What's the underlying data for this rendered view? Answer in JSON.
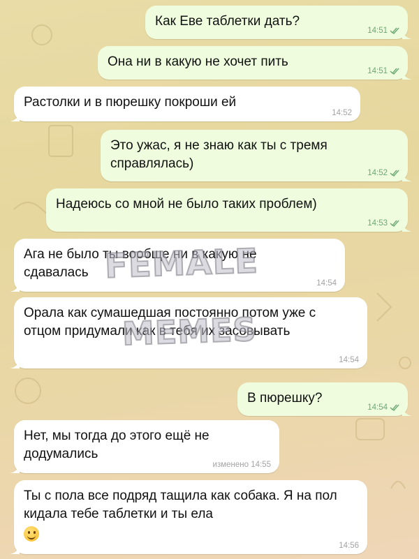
{
  "messages": [
    {
      "dir": "out",
      "text": "Как Еве таблетки дать?",
      "time": "14:51",
      "read": true
    },
    {
      "dir": "out",
      "text": "Она ни в какую не хочет пить",
      "time": "14:51",
      "read": true
    },
    {
      "dir": "in",
      "text": "Растолки и в пюрешку покроши ей",
      "time": "14:52"
    },
    {
      "dir": "out",
      "text": "Это ужас, я не знаю как ты с тремя справлялась)",
      "time": "14:52",
      "read": true
    },
    {
      "dir": "out",
      "text": "Надеюсь со мной не было таких проблем)",
      "time": "14:53",
      "read": true
    },
    {
      "dir": "in",
      "text": "Ага не было ты вообще ни в какую не сдавалась",
      "time": "14:54"
    },
    {
      "dir": "in",
      "text": "Орала как сумашедшая постоянно потом уже с отцом придумали как в тебя их засовывать",
      "time": "14:54"
    },
    {
      "dir": "out",
      "text": "В пюрешку?",
      "time": "14:54",
      "read": true
    },
    {
      "dir": "in",
      "text": "Нет, мы тогда до этого ещё не додумались",
      "time": "изменено 14:55"
    },
    {
      "dir": "in",
      "text": "Ты с пола все подряд тащила как собака. Я на пол кидала тебе таблетки и ты ела",
      "time": "14:56",
      "emoji": "smiling-face"
    }
  ],
  "watermark": {
    "line1": "FEMALE",
    "line2": "MEMES"
  },
  "colors": {
    "outgoing": "#effdde",
    "incoming": "#ffffff",
    "read_check": "#6aa872",
    "wallpaper": "#e9dca6"
  }
}
